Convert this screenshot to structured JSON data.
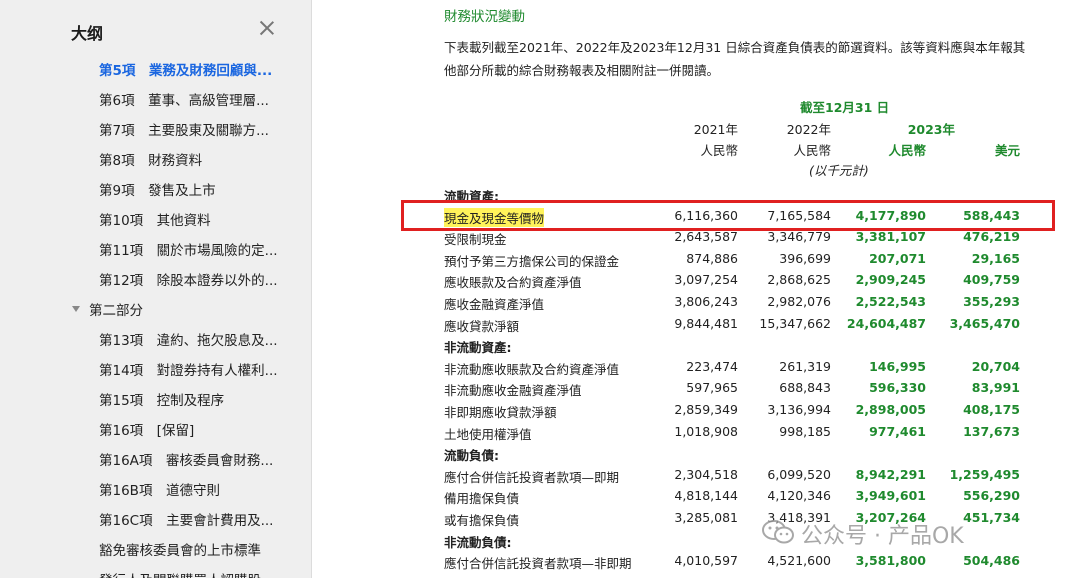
{
  "sidebar": {
    "title": "大纲",
    "items": [
      {
        "label": "第5項　業務及財務回顧與...",
        "active": true
      },
      {
        "label": "第6項　董事、高級管理層..."
      },
      {
        "label": "第7項　主要股東及關聯方..."
      },
      {
        "label": "第8項　財務資料"
      },
      {
        "label": "第9項　發售及上市"
      },
      {
        "label": "第10項　其他資料"
      },
      {
        "label": "第11項　關於市場風險的定..."
      },
      {
        "label": "第12項　除股本證券以外的..."
      },
      {
        "label": "第二部分",
        "group": true
      },
      {
        "label": "第13項　違約、拖欠股息及..."
      },
      {
        "label": "第14項　對證券持有人權利..."
      },
      {
        "label": "第15項　控制及程序"
      },
      {
        "label": "第16項　[保留]"
      },
      {
        "label": "第16A項　審核委員會財務..."
      },
      {
        "label": "第16B項　道德守則"
      },
      {
        "label": "第16C項　主要會計費用及..."
      },
      {
        "label": "豁免審核委員會的上市標準"
      },
      {
        "label": "發行人及關聯購買人認購股..."
      }
    ]
  },
  "doc": {
    "section_title": "財務狀況變動",
    "intro_line1": "下表載列截至2021年、2022年及2023年12月31 日綜合資產負債表的節選資料。該等資料應與本年報其",
    "intro_line2": "他部分所載的綜合財務報表及相關附註一併閱讀。",
    "header": {
      "as_of": "截至12月31 日",
      "y2021": "2021年",
      "y2022": "2022年",
      "y2023": "2023年",
      "rmb1": "人民幣",
      "rmb2": "人民幣",
      "rmb3": "人民幣",
      "usd": "美元",
      "unit": "(以千元計)"
    },
    "rows": [
      {
        "label": "流動資產:",
        "section": true
      },
      {
        "label": "現金及現金等價物",
        "v2021": "6,116,360",
        "v2022": "7,165,584",
        "v2023": "4,177,890",
        "usd": "588,443",
        "highlight": true
      },
      {
        "label": "受限制現金",
        "v2021": "2,643,587",
        "v2022": "3,346,779",
        "v2023": "3,381,107",
        "usd": "476,219"
      },
      {
        "label": "預付予第三方擔保公司的保證金",
        "v2021": "874,886",
        "v2022": "396,699",
        "v2023": "207,071",
        "usd": "29,165"
      },
      {
        "label": "應收賬款及合約資產淨值",
        "v2021": "3,097,254",
        "v2022": "2,868,625",
        "v2023": "2,909,245",
        "usd": "409,759"
      },
      {
        "label": "應收金融資產淨值",
        "v2021": "3,806,243",
        "v2022": "2,982,076",
        "v2023": "2,522,543",
        "usd": "355,293"
      },
      {
        "label": "應收貸款淨額",
        "v2021": "9,844,481",
        "v2022": "15,347,662",
        "v2023": "24,604,487",
        "usd": "3,465,470"
      },
      {
        "label": "非流動資產:",
        "section": true
      },
      {
        "label": "非流動應收賬款及合約資產淨值",
        "v2021": "223,474",
        "v2022": "261,319",
        "v2023": "146,995",
        "usd": "20,704"
      },
      {
        "label": "非流動應收金融資產淨值",
        "v2021": "597,965",
        "v2022": "688,843",
        "v2023": "596,330",
        "usd": "83,991"
      },
      {
        "label": "非即期應收貸款淨額",
        "v2021": "2,859,349",
        "v2022": "3,136,994",
        "v2023": "2,898,005",
        "usd": "408,175"
      },
      {
        "label": "土地使用權淨值",
        "v2021": "1,018,908",
        "v2022": "998,185",
        "v2023": "977,461",
        "usd": "137,673"
      },
      {
        "label": "流動負債:",
        "section": true
      },
      {
        "label": "應付合併信託投資者款項—即期",
        "v2021": "2,304,518",
        "v2022": "6,099,520",
        "v2023": "8,942,291",
        "usd": "1,259,495"
      },
      {
        "label": "備用擔保負債",
        "v2021": "4,818,144",
        "v2022": "4,120,346",
        "v2023": "3,949,601",
        "usd": "556,290"
      },
      {
        "label": "或有擔保負債",
        "v2021": "3,285,081",
        "v2022": "3,418,391",
        "v2023": "3,207,264",
        "usd": "451,734"
      },
      {
        "label": "非流動負債:",
        "section": true
      },
      {
        "label": "應付合併信託投資者款項—非即期",
        "v2021": "4,010,597",
        "v2022": "4,521,600",
        "v2023": "3,581,800",
        "usd": "504,486"
      }
    ]
  },
  "watermark": "公众号 · 产品OK",
  "colors": {
    "accent_green": "#1f8a2e",
    "highlight_box": "#e02020",
    "link_blue": "#1a66e0"
  }
}
